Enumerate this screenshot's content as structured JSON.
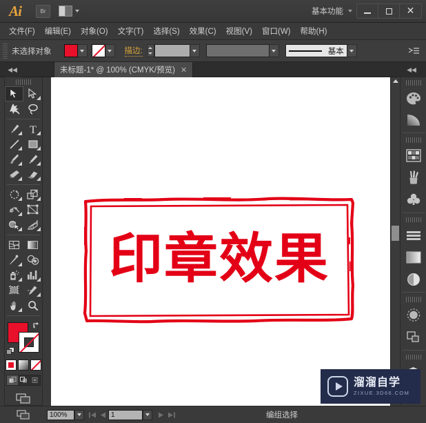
{
  "app": {
    "name": "Ai",
    "logo_label": "Ai",
    "bridge_label": "Br",
    "arrange_label": "arrange-documents",
    "workspace": "基本功能"
  },
  "window_controls": {
    "minimize": "minimize-icon",
    "maximize": "maximize-icon",
    "close": "✕"
  },
  "menubar": {
    "items": [
      {
        "label": "文件(F)"
      },
      {
        "label": "编辑(E)"
      },
      {
        "label": "对象(O)"
      },
      {
        "label": "文字(T)"
      },
      {
        "label": "选择(S)"
      },
      {
        "label": "效果(C)"
      },
      {
        "label": "视图(V)"
      },
      {
        "label": "窗口(W)"
      },
      {
        "label": "帮助(H)"
      }
    ]
  },
  "optionbar": {
    "selection_label": "未选择对象",
    "fill_color": "#E8102A",
    "stroke_color": "none",
    "stroke_label": "描边:",
    "stroke_weight_value": "",
    "profile_value": "",
    "style_label": "基本",
    "panel_menu_icon": "panel-menu-icon"
  },
  "document_tab": {
    "title": "未标题-1* @ 100% (CMYK/预览)",
    "close": "✕",
    "collapse_left": "◀◀",
    "collapse_right": "◀◀"
  },
  "toolbar": {
    "tools": [
      {
        "name": "selection-tool",
        "active": true,
        "submenu": false
      },
      {
        "name": "direct-selection-tool",
        "active": false,
        "submenu": true
      },
      {
        "name": "magic-wand-tool",
        "active": false,
        "submenu": false
      },
      {
        "name": "lasso-tool",
        "active": false,
        "submenu": false
      },
      {
        "name": "pen-tool",
        "active": false,
        "submenu": true
      },
      {
        "name": "type-tool",
        "active": false,
        "submenu": true
      },
      {
        "name": "line-segment-tool",
        "active": false,
        "submenu": true
      },
      {
        "name": "rectangle-tool",
        "active": false,
        "submenu": true
      },
      {
        "name": "paintbrush-tool",
        "active": false,
        "submenu": true
      },
      {
        "name": "pencil-tool",
        "active": false,
        "submenu": true
      },
      {
        "name": "blob-brush-tool",
        "active": false,
        "submenu": false
      },
      {
        "name": "eraser-tool",
        "active": false,
        "submenu": true
      },
      {
        "name": "rotate-tool",
        "active": false,
        "submenu": true
      },
      {
        "name": "scale-tool",
        "active": false,
        "submenu": true
      },
      {
        "name": "width-tool",
        "active": false,
        "submenu": true
      },
      {
        "name": "free-transform-tool",
        "active": false,
        "submenu": false
      },
      {
        "name": "shape-builder-tool",
        "active": false,
        "submenu": true
      },
      {
        "name": "perspective-grid-tool",
        "active": false,
        "submenu": true
      },
      {
        "name": "mesh-tool",
        "active": false,
        "submenu": false
      },
      {
        "name": "gradient-tool",
        "active": false,
        "submenu": false
      },
      {
        "name": "eyedropper-tool",
        "active": false,
        "submenu": true
      },
      {
        "name": "blend-tool",
        "active": false,
        "submenu": false
      },
      {
        "name": "symbol-sprayer-tool",
        "active": false,
        "submenu": true
      },
      {
        "name": "column-graph-tool",
        "active": false,
        "submenu": true
      },
      {
        "name": "artboard-tool",
        "active": false,
        "submenu": false
      },
      {
        "name": "slice-tool",
        "active": false,
        "submenu": true
      },
      {
        "name": "hand-tool",
        "active": false,
        "submenu": true
      },
      {
        "name": "zoom-tool",
        "active": false,
        "submenu": false
      }
    ],
    "fill_color": "#E8102A",
    "stroke_color": "none",
    "modes": [
      "solid-color-mode",
      "gradient-mode",
      "none-mode"
    ],
    "draw_modes": [
      "draw-normal",
      "draw-behind",
      "draw-inside"
    ],
    "screen_mode": "screen-mode-icon"
  },
  "right_dock": {
    "panels": [
      {
        "name": "color-panel-icon"
      },
      {
        "name": "gradient-panel-icon"
      },
      {
        "name": "swatches-panel-icon"
      },
      {
        "name": "brushes-panel-icon"
      },
      {
        "name": "symbols-panel-icon"
      },
      {
        "name": "align-panel-icon"
      },
      {
        "name": "transparency-panel-icon"
      },
      {
        "name": "appearance-panel-icon"
      },
      {
        "name": "graphic-styles-panel-icon"
      },
      {
        "name": "pathfinder-panel-icon"
      },
      {
        "name": "layers-panel-icon"
      },
      {
        "name": "artboards-panel-icon"
      }
    ],
    "collapse": "◀◀"
  },
  "canvas": {
    "artwork": {
      "type": "stamp",
      "text": "印章效果",
      "color": "#E30016",
      "border_color": "#E30016",
      "background": "#FFFFFF"
    }
  },
  "statusbar": {
    "zoom": "100%",
    "page": "1",
    "status_text": "编组选择",
    "first_page_icon": "first-page-icon",
    "prev_page_icon": "prev-page-icon",
    "next_page_icon": "next-page-icon",
    "last_page_icon": "last-page-icon"
  },
  "watermark": {
    "title": "溜溜自学",
    "subtitle": "ZIXUE.3D66.COM",
    "logo": "play-button-icon",
    "bg_color": "#232C4A"
  }
}
